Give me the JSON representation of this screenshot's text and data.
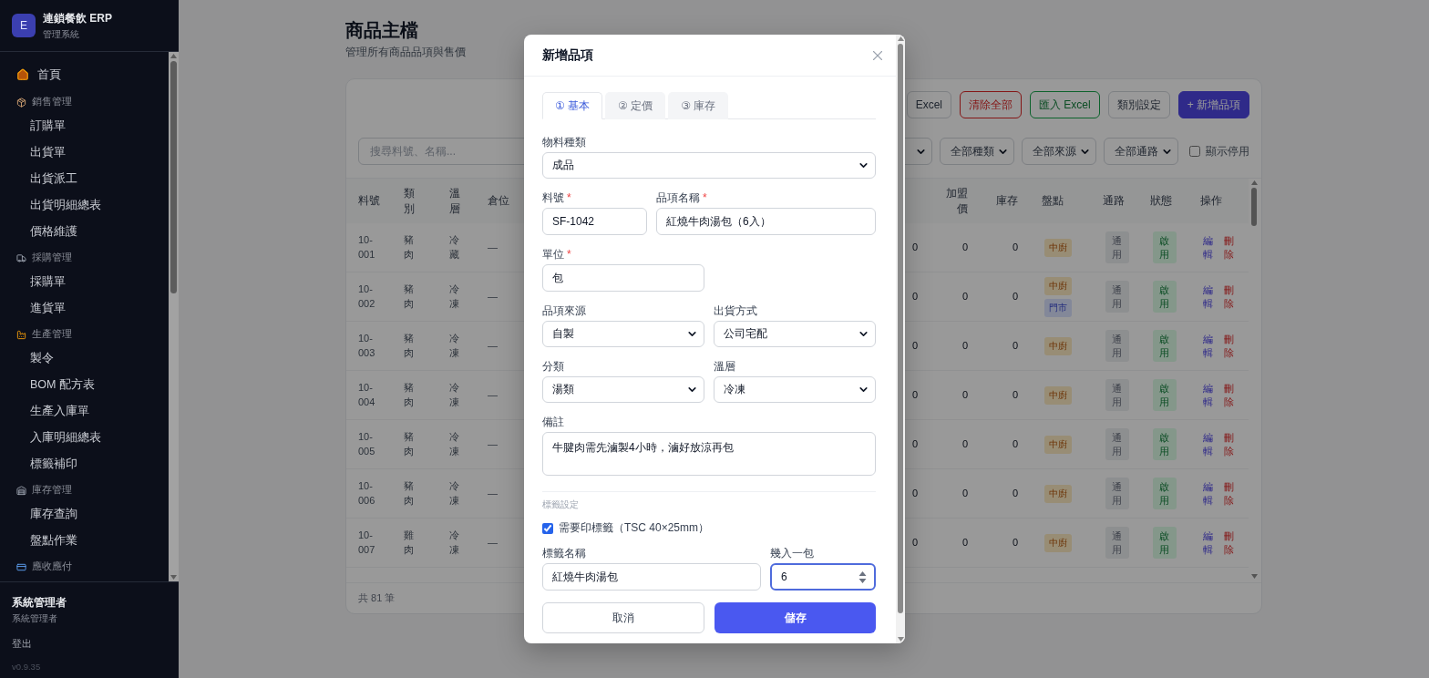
{
  "sidebar": {
    "logo": "E",
    "app_name": "連鎖餐飲 ERP",
    "app_subtitle": "管理系統",
    "nav": [
      {
        "kind": "link",
        "label": "首頁"
      },
      {
        "kind": "section",
        "label": "銷售管理",
        "children": [
          {
            "label": "訂購單"
          },
          {
            "label": "出貨單"
          },
          {
            "label": "出貨派工"
          },
          {
            "label": "出貨明細總表"
          },
          {
            "label": "價格維護"
          }
        ]
      },
      {
        "kind": "section",
        "label": "採購管理",
        "children": [
          {
            "label": "採購單"
          },
          {
            "label": "進貨單"
          }
        ]
      },
      {
        "kind": "section",
        "label": "生產管理",
        "children": [
          {
            "label": "製令"
          },
          {
            "label": "BOM 配方表"
          },
          {
            "label": "生產入庫單"
          },
          {
            "label": "入庫明細總表"
          },
          {
            "label": "標籤補印"
          }
        ]
      },
      {
        "kind": "section",
        "label": "庫存管理",
        "children": [
          {
            "label": "庫存查詢"
          },
          {
            "label": "盤點作業"
          }
        ]
      },
      {
        "kind": "section",
        "label": "應收應付"
      }
    ],
    "user": {
      "name": "系統管理者",
      "role": "系統管理者",
      "logout": "登出",
      "version": "v0.9.35"
    }
  },
  "page": {
    "title": "商品主檔",
    "subtitle": "管理所有商品品項與售價"
  },
  "toolbar": [
    {
      "label": "Excel",
      "kind": "outline"
    },
    {
      "label": "清除全部",
      "kind": "danger"
    },
    {
      "label": "匯入 Excel",
      "kind": "success"
    },
    {
      "label": "類別設定",
      "kind": "outline"
    },
    {
      "label": "+ 新增品項",
      "kind": "primary"
    }
  ],
  "filters": {
    "search": {
      "placeholder": "搜尋料號、名稱..."
    },
    "selects": [
      "全部種類",
      "全部來源",
      "全部通路"
    ],
    "show_disabled": {
      "label": "顯示停用",
      "checked": false
    }
  },
  "table": {
    "left_columns": [
      "料號",
      "類別",
      "溫層",
      "倉位"
    ],
    "right_columns": [
      "加盟價",
      "庫存",
      "盤點",
      "通路",
      "狀態",
      "操作"
    ],
    "rows": [
      {
        "code": "10-001",
        "category": "豬肉",
        "temperature": "冷藏",
        "location": "—",
        "column_5": "0",
        "franchise_price": "0",
        "stock": "0",
        "count_sites": [
          {
            "label": "中廚",
            "kind": "kitchen"
          }
        ],
        "channel": "通用",
        "status": "啟用",
        "actions": [
          {
            "label": "編輯",
            "kind": "edit"
          },
          {
            "label": "刪除",
            "kind": "delete"
          }
        ]
      },
      {
        "code": "10-002",
        "category": "豬肉",
        "temperature": "冷凍",
        "location": "—",
        "column_5": "0",
        "franchise_price": "0",
        "stock": "0",
        "count_sites": [
          {
            "label": "中廚",
            "kind": "kitchen"
          },
          {
            "label": "門市",
            "kind": "store"
          }
        ],
        "channel": "通用",
        "status": "啟用",
        "actions": [
          {
            "label": "編輯",
            "kind": "edit"
          },
          {
            "label": "刪除",
            "kind": "delete"
          }
        ]
      },
      {
        "code": "10-003",
        "category": "豬肉",
        "temperature": "冷凍",
        "location": "—",
        "column_5": "0",
        "franchise_price": "0",
        "stock": "0",
        "count_sites": [
          {
            "label": "中廚",
            "kind": "kitchen"
          }
        ],
        "channel": "通用",
        "status": "啟用",
        "actions": [
          {
            "label": "編輯",
            "kind": "edit"
          },
          {
            "label": "刪除",
            "kind": "delete"
          }
        ]
      },
      {
        "code": "10-004",
        "category": "豬肉",
        "temperature": "冷凍",
        "location": "—",
        "column_5": "0",
        "franchise_price": "0",
        "stock": "0",
        "count_sites": [
          {
            "label": "中廚",
            "kind": "kitchen"
          }
        ],
        "channel": "通用",
        "status": "啟用",
        "actions": [
          {
            "label": "編輯",
            "kind": "edit"
          },
          {
            "label": "刪除",
            "kind": "delete"
          }
        ]
      },
      {
        "code": "10-005",
        "category": "豬肉",
        "temperature": "冷凍",
        "location": "—",
        "column_5": "0",
        "franchise_price": "0",
        "stock": "0",
        "count_sites": [
          {
            "label": "中廚",
            "kind": "kitchen"
          }
        ],
        "channel": "通用",
        "status": "啟用",
        "actions": [
          {
            "label": "編輯",
            "kind": "edit"
          },
          {
            "label": "刪除",
            "kind": "delete"
          }
        ]
      },
      {
        "code": "10-006",
        "category": "豬肉",
        "temperature": "冷凍",
        "location": "—",
        "column_5": "0",
        "franchise_price": "0",
        "stock": "0",
        "count_sites": [
          {
            "label": "中廚",
            "kind": "kitchen"
          }
        ],
        "channel": "通用",
        "status": "啟用",
        "actions": [
          {
            "label": "編輯",
            "kind": "edit"
          },
          {
            "label": "刪除",
            "kind": "delete"
          }
        ]
      },
      {
        "code": "10-007",
        "category": "雞肉",
        "temperature": "冷凍",
        "location": "—",
        "column_5": "0",
        "franchise_price": "0",
        "stock": "0",
        "count_sites": [
          {
            "label": "中廚",
            "kind": "kitchen"
          }
        ],
        "channel": "通用",
        "status": "啟用",
        "actions": [
          {
            "label": "編輯",
            "kind": "edit"
          },
          {
            "label": "刪除",
            "kind": "delete"
          }
        ]
      }
    ],
    "footer": "共 81 筆"
  },
  "modal": {
    "title": "新增品項",
    "tabs": [
      {
        "label": "① 基本",
        "selected": true
      },
      {
        "label": "② 定價",
        "selected": false
      },
      {
        "label": "③ 庫存",
        "selected": false
      }
    ],
    "material_type": {
      "label": "物料種類",
      "value": "成品"
    },
    "code": {
      "label": "料號",
      "mark": "*",
      "value": "SF-1042"
    },
    "name": {
      "label": "品項名稱",
      "mark": "*",
      "value": "紅燒牛肉湯包（6入）"
    },
    "unit": {
      "label": "單位",
      "mark": "*",
      "value": "包"
    },
    "source": {
      "label": "品項來源",
      "value": "自製"
    },
    "shipping": {
      "label": "出貨方式",
      "value": "公司宅配"
    },
    "category": {
      "label": "分類",
      "value": "湯類"
    },
    "temperature": {
      "label": "溫層",
      "value": "冷凍"
    },
    "note": {
      "label": "備註",
      "value": "牛腱肉需先滷製4小時，滷好放涼再包"
    },
    "label_settings": {
      "heading": "標籤設定",
      "print_label": {
        "label": "需要印標籤（TSC 40×25mm）",
        "checked": true
      },
      "label_name": {
        "label": "標籤名稱",
        "value": "紅燒牛肉湯包"
      },
      "pack_count": {
        "label": "幾入一包",
        "value": "6",
        "focused": true
      }
    },
    "buttons": {
      "cancel": "取消",
      "save": "儲存"
    }
  }
}
